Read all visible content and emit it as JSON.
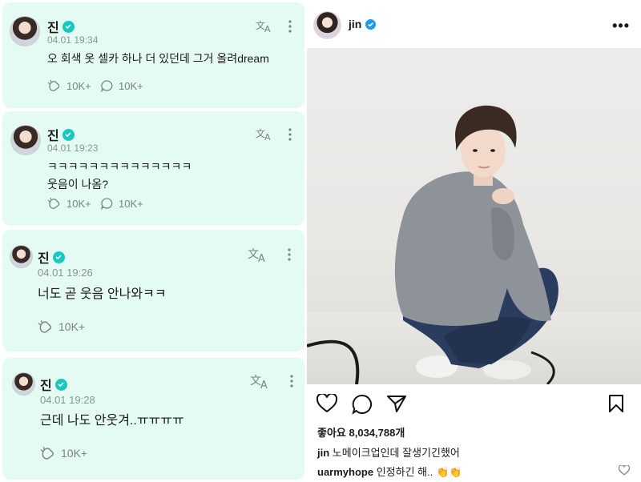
{
  "posts": [
    {
      "name": "진",
      "time": "04.01 19:34",
      "text": "오 회색 옷 셀카 하나 더 있던데 그거 올려dream",
      "likes": "10K+",
      "comments": "10K+"
    },
    {
      "name": "진",
      "time": "04.01 19:23",
      "text": "ㅋㅋㅋㅋㅋㅋㅋㅋㅋㅋㅋㅋㅋㅋ\n웃음이 나옴?",
      "likes": "10K+",
      "comments": "10K+"
    },
    {
      "name": "진",
      "time": "04.01 19:26",
      "text": "너도 곧 웃음 안나와ㅋㅋ",
      "likes": "10K+"
    },
    {
      "name": "진",
      "time": "04.01 19:28",
      "text": "근데 나도 안웃겨..ㅠㅠㅠㅠ",
      "likes": "10K+"
    }
  ],
  "instagram": {
    "username": "jin",
    "likes_text": "좋아요 8,034,788개",
    "caption_user": "jin",
    "caption_text": "노메이크업인데 잘생기긴했어",
    "comment_user": "uarmyhope",
    "comment_text": "인정하긴 해.. 👏👏"
  },
  "colors": {
    "card_bg": "#e3fbf3",
    "verified": "#18c7c0",
    "ig_verified": "#1d9bf0"
  }
}
